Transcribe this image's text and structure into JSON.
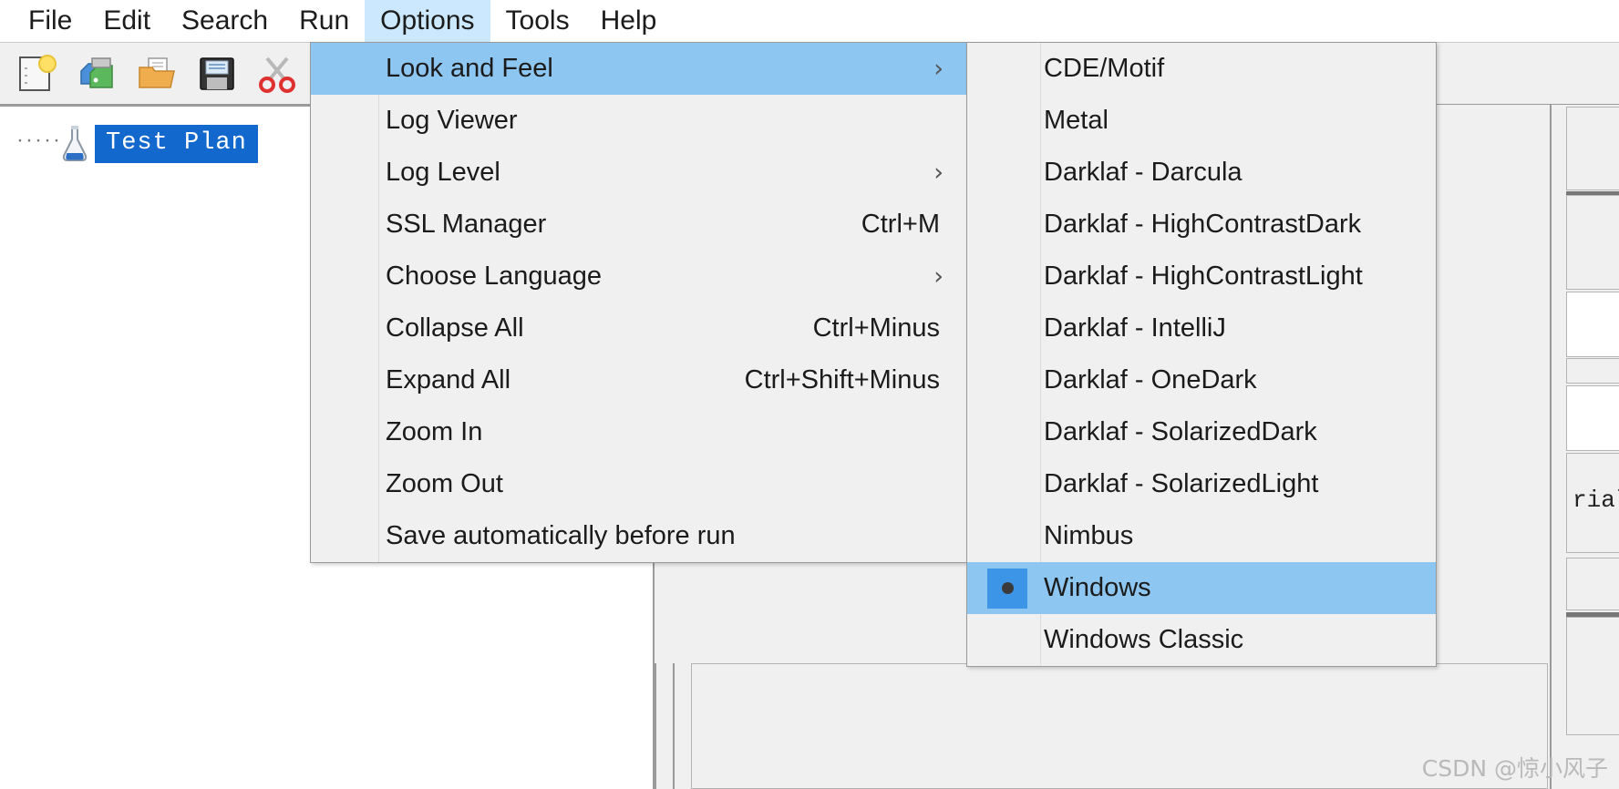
{
  "menubar": {
    "items": [
      {
        "label": "File",
        "active": false
      },
      {
        "label": "Edit",
        "active": false
      },
      {
        "label": "Search",
        "active": false
      },
      {
        "label": "Run",
        "active": false
      },
      {
        "label": "Options",
        "active": true
      },
      {
        "label": "Tools",
        "active": false
      },
      {
        "label": "Help",
        "active": false
      }
    ]
  },
  "toolbar": {
    "buttons": [
      {
        "name": "new-test-plan-icon",
        "title": "New"
      },
      {
        "name": "templates-icon",
        "title": "Templates"
      },
      {
        "name": "open-folder-icon",
        "title": "Open"
      },
      {
        "name": "save-floppy-icon",
        "title": "Save"
      },
      {
        "name": "cut-scissors-icon",
        "title": "Cut"
      }
    ]
  },
  "tree": {
    "root_label": "Test Plan",
    "root_icon": "test-plan-flask-icon"
  },
  "options_menu": {
    "items": [
      {
        "label": "Look and Feel",
        "accel": "",
        "arrow": "›",
        "selected": true
      },
      {
        "label": "Log Viewer",
        "accel": "",
        "arrow": "",
        "selected": false
      },
      {
        "label": "Log Level",
        "accel": "",
        "arrow": "›",
        "selected": false
      },
      {
        "label": "SSL Manager",
        "accel": "Ctrl+M",
        "arrow": "",
        "selected": false
      },
      {
        "label": "Choose Language",
        "accel": "",
        "arrow": "›",
        "selected": false
      },
      {
        "label": "Collapse All",
        "accel": "Ctrl+Minus",
        "arrow": "",
        "selected": false
      },
      {
        "label": "Expand All",
        "accel": "Ctrl+Shift+Minus",
        "arrow": "",
        "selected": false
      },
      {
        "label": "Zoom In",
        "accel": "",
        "arrow": "",
        "selected": false
      },
      {
        "label": "Zoom Out",
        "accel": "",
        "arrow": "",
        "selected": false
      },
      {
        "label": "Save automatically before run",
        "accel": "",
        "arrow": "",
        "selected": false
      }
    ]
  },
  "look_and_feel_menu": {
    "items": [
      {
        "label": "CDE/Motif",
        "selected": false,
        "checked": false
      },
      {
        "label": "Metal",
        "selected": false,
        "checked": false
      },
      {
        "label": "Darklaf - Darcula",
        "selected": false,
        "checked": false
      },
      {
        "label": "Darklaf - HighContrastDark",
        "selected": false,
        "checked": false
      },
      {
        "label": "Darklaf - HighContrastLight",
        "selected": false,
        "checked": false
      },
      {
        "label": "Darklaf - IntelliJ",
        "selected": false,
        "checked": false
      },
      {
        "label": "Darklaf - OneDark",
        "selected": false,
        "checked": false
      },
      {
        "label": "Darklaf - SolarizedDark",
        "selected": false,
        "checked": false
      },
      {
        "label": "Darklaf - SolarizedLight",
        "selected": false,
        "checked": false
      },
      {
        "label": "Nimbus",
        "selected": false,
        "checked": false
      },
      {
        "label": "Windows",
        "selected": true,
        "checked": true
      },
      {
        "label": "Windows Classic",
        "selected": false,
        "checked": false
      }
    ]
  },
  "right_panel": {
    "partial_text": "rial"
  },
  "watermark": {
    "text": "CSDN @惊小风子"
  },
  "colors": {
    "menubar_highlight": "#cce8ff",
    "menu_selection": "#8dc6f0",
    "tree_selection": "#1368ce",
    "radio_box": "#3d95e8",
    "menu_background": "#f0f0f0"
  }
}
